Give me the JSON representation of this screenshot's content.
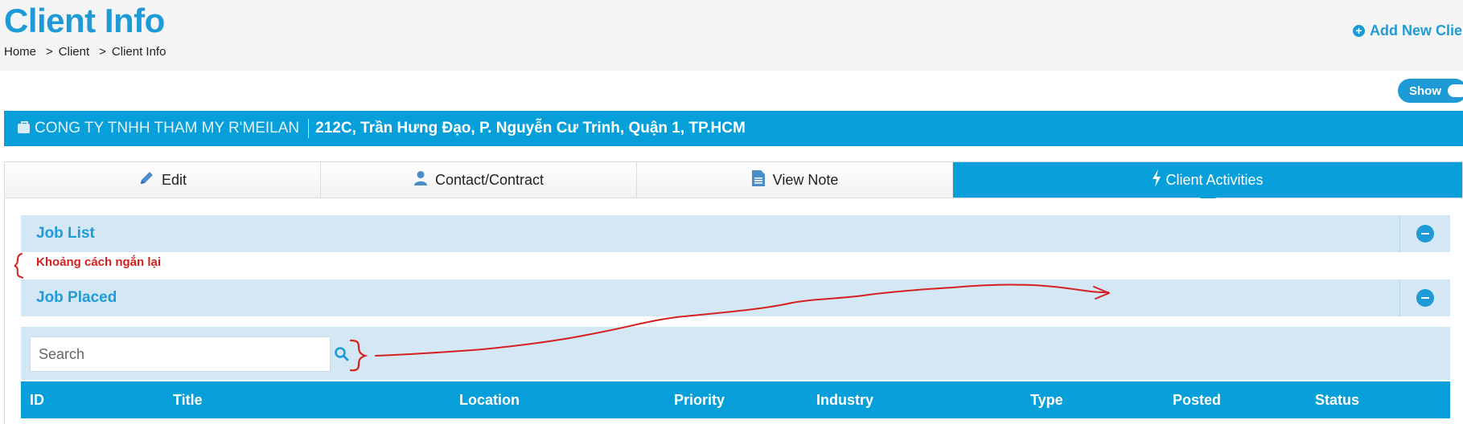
{
  "header": {
    "title": "Client Info",
    "breadcrumb": [
      "Home",
      "Client",
      "Client Info"
    ],
    "breadcrumb_separator": ">",
    "add_button_label": "Add New Client"
  },
  "toggle": {
    "label": "Show"
  },
  "client": {
    "name": "CONG TY TNHH THAM MY R'MEILAN",
    "address": "212C, Trần Hưng Đạo, P. Nguyễn Cư Trinh, Quận 1, TP.HCM"
  },
  "tabs": [
    {
      "label": "Edit",
      "icon": "pencil-icon",
      "active": false
    },
    {
      "label": "Contact/Contract",
      "icon": "user-icon",
      "active": false
    },
    {
      "label": "View Note",
      "icon": "document-icon",
      "active": false
    },
    {
      "label": "Client Activities",
      "icon": "bolt-icon",
      "active": true
    }
  ],
  "panels": {
    "job_list": "Job List",
    "job_placed": "Job Placed"
  },
  "annotation": {
    "text": "Khoảng cách ngắn lại",
    "color": "#d62020"
  },
  "search": {
    "placeholder": "Search",
    "value": ""
  },
  "table": {
    "columns": [
      "ID",
      "Title",
      "Location",
      "Priority",
      "Industry",
      "Type",
      "Posted",
      "Status"
    ]
  },
  "colors": {
    "accent": "#1e9bd7",
    "bar": "#079fda",
    "panel_bg": "#d4e7f5",
    "annotation": "#d62020"
  }
}
